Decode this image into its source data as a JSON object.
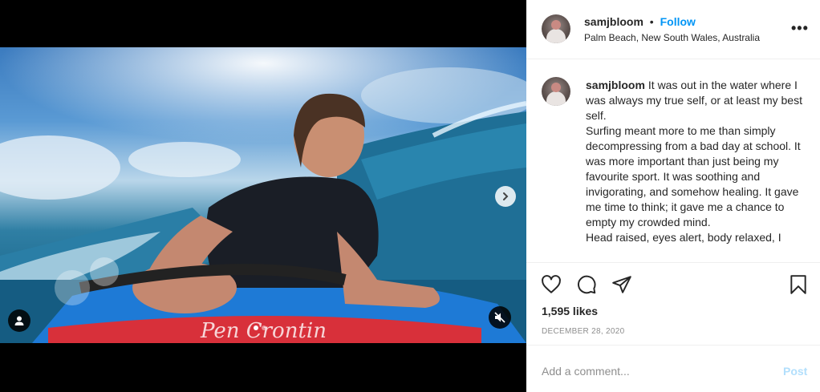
{
  "post": {
    "username": "samjbloom",
    "separator": "•",
    "follow_label": "Follow",
    "location": "Palm Beach, New South Wales, Australia",
    "more_label": "•••",
    "caption_lines": [
      "It was out in the water where I was always my true self, or at least my best self.",
      "Surfing meant more to me than simply decompressing from a bad day at school. It was more important than just being my favourite sport. It was soothing and invigorating, and somehow healing. It gave me time to think; it gave me a chance to empty my crowded mind.",
      "Head raised, eyes alert, body relaxed, I"
    ],
    "likes": "1,595 likes",
    "date": "DECEMBER 28, 2020",
    "comment_placeholder": "Add a comment...",
    "post_label": "Post"
  },
  "media": {
    "carousel_count": 2,
    "active_index": 0,
    "description_icons": [
      "chevron-right-icon",
      "user-tag-icon",
      "muted-speaker-icon"
    ]
  },
  "icons": {
    "like": "heart-icon",
    "comment": "comment-icon",
    "share": "paper-plane-icon",
    "save": "bookmark-icon"
  },
  "colors": {
    "accent": "#0095f6",
    "post_disabled": "#b2dffc",
    "muted_text": "#8e8e8e",
    "border": "#efefef"
  }
}
